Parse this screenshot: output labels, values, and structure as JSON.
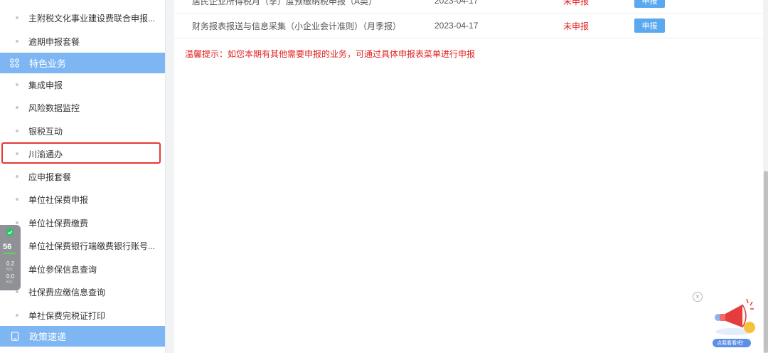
{
  "sidebar": {
    "items_top": [
      {
        "label": "主附税文化事业建设费联合申报..."
      },
      {
        "label": "逾期申报套餐"
      }
    ],
    "section_feature": {
      "label": "特色业务",
      "icon": "grid-icon"
    },
    "feature_items": [
      {
        "label": "集成申报"
      },
      {
        "label": "风险数据监控"
      },
      {
        "label": "银税互动"
      },
      {
        "label": "川渝通办"
      },
      {
        "label": "应申报套餐"
      },
      {
        "label": "单位社保费申报"
      },
      {
        "label": "单位社保费缴费"
      },
      {
        "label": "单位社保费银行端缴费银行账号..."
      },
      {
        "label": "单位参保信息查询"
      },
      {
        "label": "社保费应缴信息查询"
      },
      {
        "label": "单社保费完税证打印"
      }
    ],
    "section_policy": {
      "label": "政策速递",
      "icon": "tablet-icon"
    }
  },
  "main": {
    "rows": [
      {
        "name": "居民企业所得税月（季）度预缴纳税申报（A类）",
        "date": "2023-04-17",
        "status": "未申报",
        "action": "申报"
      },
      {
        "name": "财务报表报送与信息采集（小企业会计准则）（月季报）",
        "date": "2023-04-17",
        "status": "未申报",
        "action": "申报"
      }
    ],
    "tip": "温馨提示：如您本期有其他需要申报的业务，可通过具体申报表菜单进行申报"
  },
  "monitor": {
    "score": "56",
    "up": "0.2",
    "up_unit": "K/s",
    "down": "0.0",
    "down_unit": "K/s"
  },
  "promo": {
    "caption": "点我看看吧！",
    "close": "×"
  },
  "colors": {
    "section_bg": "#7eb6f3",
    "button_bg": "#5aa9f0",
    "status_red": "#e02020",
    "highlight": "#e53935"
  }
}
